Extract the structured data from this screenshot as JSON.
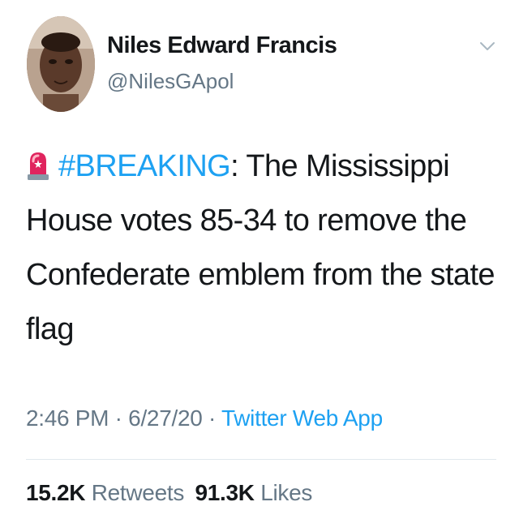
{
  "tweet": {
    "author": {
      "name": "Niles Edward Francis",
      "handle": "@NilesGApol",
      "avatar_icon": "avatar-photo"
    },
    "menu_icon": "chevron-down-icon",
    "body": {
      "emoji_icon": "siren-icon",
      "hashtag": "#BREAKING",
      "text": ": The Mississippi House votes 85-34 to remove the Confederate emblem from the state flag"
    },
    "meta": {
      "time": "2:46 PM",
      "separator1": " · ",
      "date": "6/27/20",
      "separator2": " · ",
      "source": "Twitter Web App"
    },
    "stats": {
      "retweets_count": "15.2K",
      "retweets_label": "Retweets",
      "likes_count": "91.3K",
      "likes_label": "Likes"
    },
    "colors": {
      "link": "#1da1f2",
      "secondary": "#657786",
      "primary": "#14171a"
    }
  }
}
